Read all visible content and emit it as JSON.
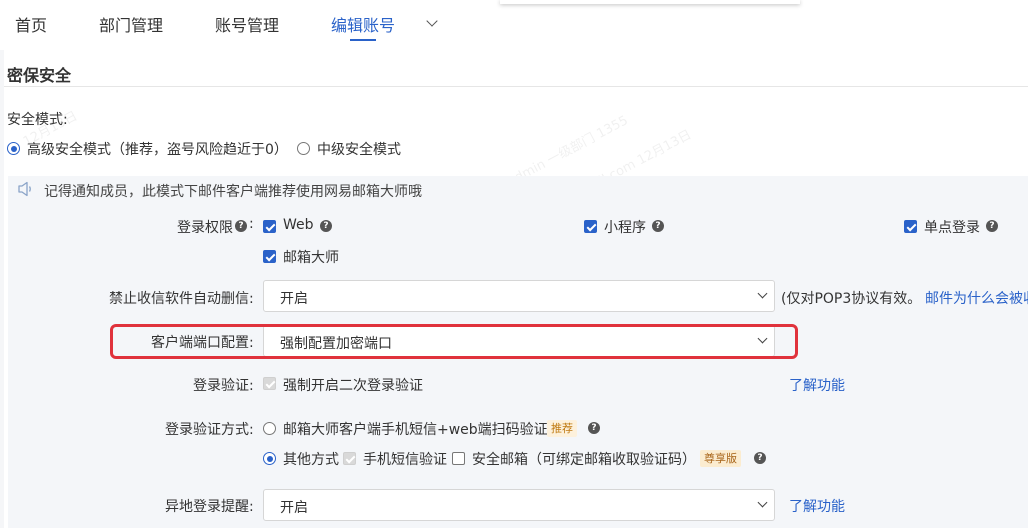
{
  "nav": {
    "items": [
      "首页",
      "部门管理",
      "账号管理",
      "编辑账号"
    ],
    "active_index": 3,
    "more_icon": "chevron-down-icon"
  },
  "section": {
    "title": "密保安全"
  },
  "security_mode": {
    "label": "安全模式:",
    "options": [
      {
        "label": "高级安全模式（推荐，盗号风险趋近于0）",
        "selected": true
      },
      {
        "label": "中级安全模式",
        "selected": false
      }
    ]
  },
  "notice": {
    "icon": "speaker-icon",
    "text": "记得通知成员，此模式下邮件客户端推荐使用网易邮箱大师哦"
  },
  "login_permission": {
    "label": "登录权限",
    "options": [
      {
        "label": "Web",
        "checked": true,
        "help": true
      },
      {
        "label": "小程序",
        "checked": true,
        "help": true
      },
      {
        "label": "单点登录",
        "checked": true,
        "help": true
      },
      {
        "label": "邮箱大师",
        "checked": true,
        "help": false
      }
    ]
  },
  "auto_delete": {
    "label": "禁止收信软件自动删信:",
    "value": "开启",
    "note_prefix": "(仅对POP3协议有效。",
    "note_link": "邮件为什么会被收"
  },
  "client_port": {
    "label": "客户端端口配置:",
    "value": "强制配置加密端口"
  },
  "login_verify": {
    "label": "登录验证:",
    "option": "强制开启二次登录验证",
    "checked": true,
    "disabled": true,
    "link": "了解功能"
  },
  "verify_method": {
    "label": "登录验证方式:",
    "option1": {
      "label": "邮箱大师客户端手机短信+web端扫码验证",
      "tag": "推荐",
      "selected": false
    },
    "option2": {
      "label": "其他方式",
      "selected": true,
      "sub": [
        {
          "label": "手机短信验证",
          "checked": true,
          "disabled": true
        },
        {
          "label": "安全邮箱（可绑定邮箱收取验证码）",
          "checked": false
        }
      ],
      "tag": "尊享版"
    }
  },
  "remote_login": {
    "label": "异地登录提醒:",
    "value": "开启",
    "link": "了解功能"
  },
  "watermark": [
    "admin 一级部门 1355",
    "admin@lingxi.ntesmail.com 12月13日",
    "12月13日"
  ],
  "colors": {
    "accent": "#2a62c9",
    "highlight": "#e0323c"
  }
}
